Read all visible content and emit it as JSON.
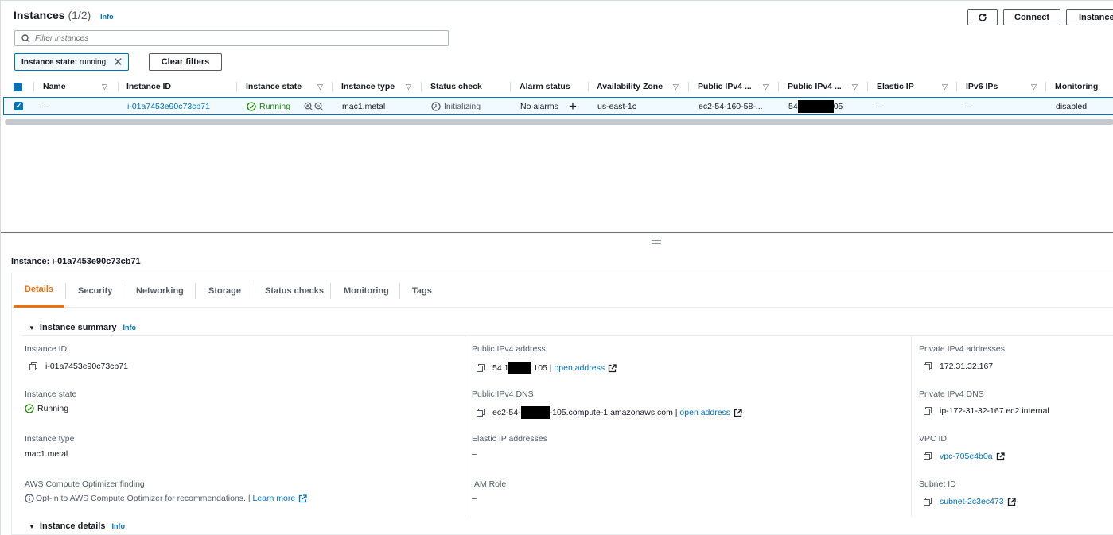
{
  "list": {
    "title": "Instances",
    "count": "(1/2)",
    "info": "Info",
    "buttons": {
      "connect": "Connect",
      "instance_state": "Instance"
    },
    "search_placeholder": "Filter instances",
    "filter_token": {
      "key": "Instance state:",
      "value": "running"
    },
    "clear_filters": "Clear filters",
    "columns": [
      "Name",
      "Instance ID",
      "Instance state",
      "Instance type",
      "Status check",
      "Alarm status",
      "Availability Zone",
      "Public IPv4 ...",
      "Public IPv4 ...",
      "Elastic IP",
      "IPv6 IPs",
      "Monitoring"
    ],
    "row": {
      "name": "–",
      "instance_id": "i-01a7453e90c73cb71",
      "state": "Running",
      "type": "mac1.metal",
      "status_check": "Initializing",
      "alarm_status": "No alarms",
      "az": "us-east-1c",
      "public_dns": "ec2-54-160-58-...",
      "public_ip_prefix": "54",
      "public_ip_suffix": "05",
      "elastic_ip": "–",
      "ipv6": "–",
      "monitoring": "disabled"
    }
  },
  "detail": {
    "title": "Instance: i-01a7453e90c73cb71",
    "tabs": [
      "Details",
      "Security",
      "Networking",
      "Storage",
      "Status checks",
      "Monitoring",
      "Tags"
    ],
    "summary_heading": "Instance summary",
    "details_heading": "Instance details",
    "info": "Info",
    "fields": {
      "instance_id_label": "Instance ID",
      "instance_id": "i-01a7453e90c73cb71",
      "instance_state_label": "Instance state",
      "instance_state": "Running",
      "instance_type_label": "Instance type",
      "instance_type": "mac1.metal",
      "optimizer_label": "AWS Compute Optimizer finding",
      "optimizer_text": "Opt-in to AWS Compute Optimizer for recommendations. |",
      "learn_more": "Learn more",
      "public_ip_label": "Public IPv4 address",
      "public_ip_prefix": "54.1",
      "public_ip_suffix": ".105 |",
      "open_address": "open address",
      "public_dns_label": "Public IPv4 DNS",
      "public_dns_prefix": "ec2-54-",
      "public_dns_suffix": "-105.compute-1.amazonaws.com |",
      "elastic_label": "Elastic IP addresses",
      "elastic_value": "–",
      "iam_label": "IAM Role",
      "iam_value": "–",
      "private_ip_label": "Private IPv4 addresses",
      "private_ip": "172.31.32.167",
      "private_dns_label": "Private IPv4 DNS",
      "private_dns": "ip-172-31-32-167.ec2.internal",
      "vpc_label": "VPC ID",
      "vpc": "vpc-705e4b0a",
      "subnet_label": "Subnet ID",
      "subnet": "subnet-2c3ec473"
    }
  },
  "colors": {
    "link": "#0073bb",
    "running": "#1d8102",
    "active_tab": "#ec7211"
  }
}
